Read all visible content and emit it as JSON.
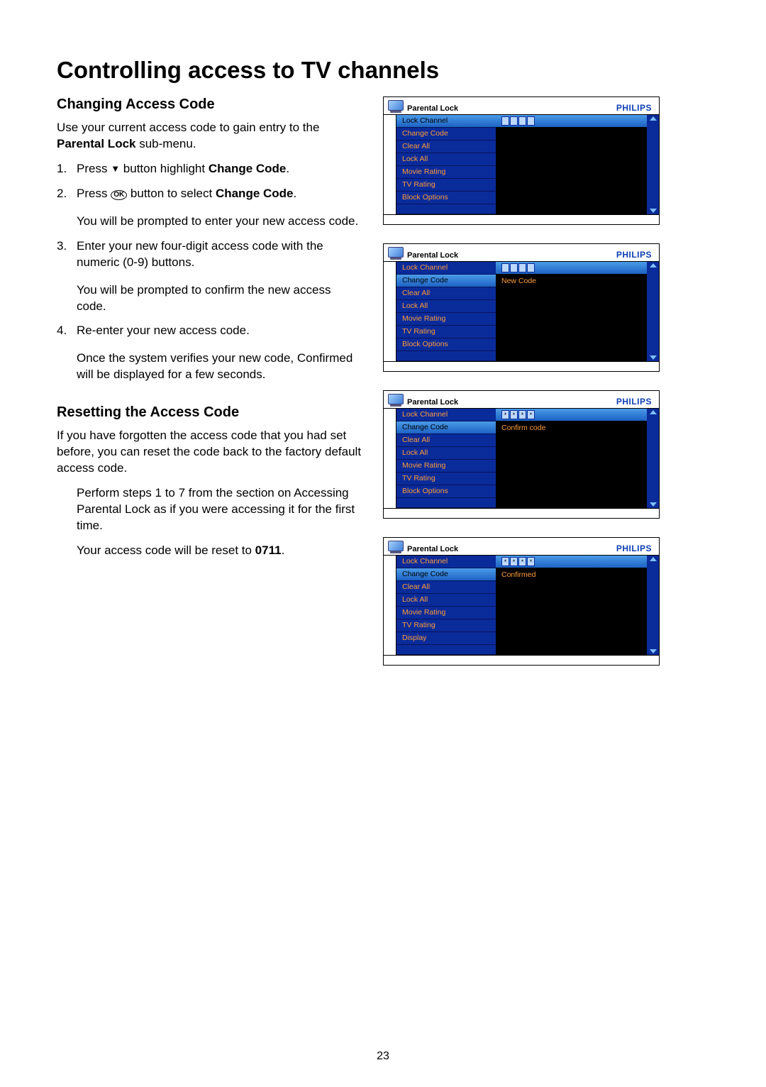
{
  "page_number": "23",
  "title": "Controlling access to TV channels",
  "section_changing": {
    "heading": "Changing Access Code",
    "intro_pre": "Use your current access code to gain entry to the ",
    "intro_bold": "Parental Lock",
    "intro_post": " sub-menu.",
    "step1_pre": "Press ",
    "step1_mid": " button highlight ",
    "step1_bold": "Change Code",
    "step1_post": ".",
    "step2_pre": "Press ",
    "step2_mid": " button to select ",
    "step2_bold": "Change Code",
    "step2_post": ".",
    "step2_extra": "You will be prompted to enter your new access code.",
    "step3": "Enter your new four-digit access code with the numeric (0-9) buttons.",
    "step3_extra": "You will be prompted to confirm the new access code.",
    "step4": "Re-enter your new access code.",
    "step4_extra": "Once the system verifies your new code, Confirmed will be displayed for a few seconds."
  },
  "section_resetting": {
    "heading": "Resetting the Access Code",
    "intro": "If you have forgotten the access code that you had set before, you can reset the code back to the factory default access code.",
    "indent_a": "Perform steps 1 to 7 from the section on Accessing Parental Lock as if you were accessing it for the first time.",
    "indent_b_pre": "Your access code will be reset to ",
    "indent_b_code": "0711",
    "indent_b_post": "."
  },
  "brand": "PHILIPS",
  "ok_label": "OK",
  "osd_common": {
    "breadcrumb": "Parental Lock",
    "items_std": [
      "Lock Channel",
      "Change Code",
      "Clear All",
      "Lock All",
      "Movie Rating",
      "TV Rating",
      "Block Options"
    ],
    "items_last": [
      "Lock Channel",
      "Change Code",
      "Clear All",
      "Lock All",
      "Movie Rating",
      "TV Rating",
      "Display"
    ]
  },
  "osd1": {
    "highlight_item_index": 0,
    "value_row0_is_code_empty": true
  },
  "osd2": {
    "highlight_item_index": 1,
    "value_row0_is_code_empty": true,
    "value_row1_text": "New Code"
  },
  "osd3": {
    "highlight_item_index": 1,
    "value_row0_is_code_star": true,
    "value_row1_text": "Confirm code"
  },
  "osd4": {
    "highlight_item_index": 1,
    "value_row0_is_code_star": true,
    "value_row1_text": "Confirmed"
  }
}
